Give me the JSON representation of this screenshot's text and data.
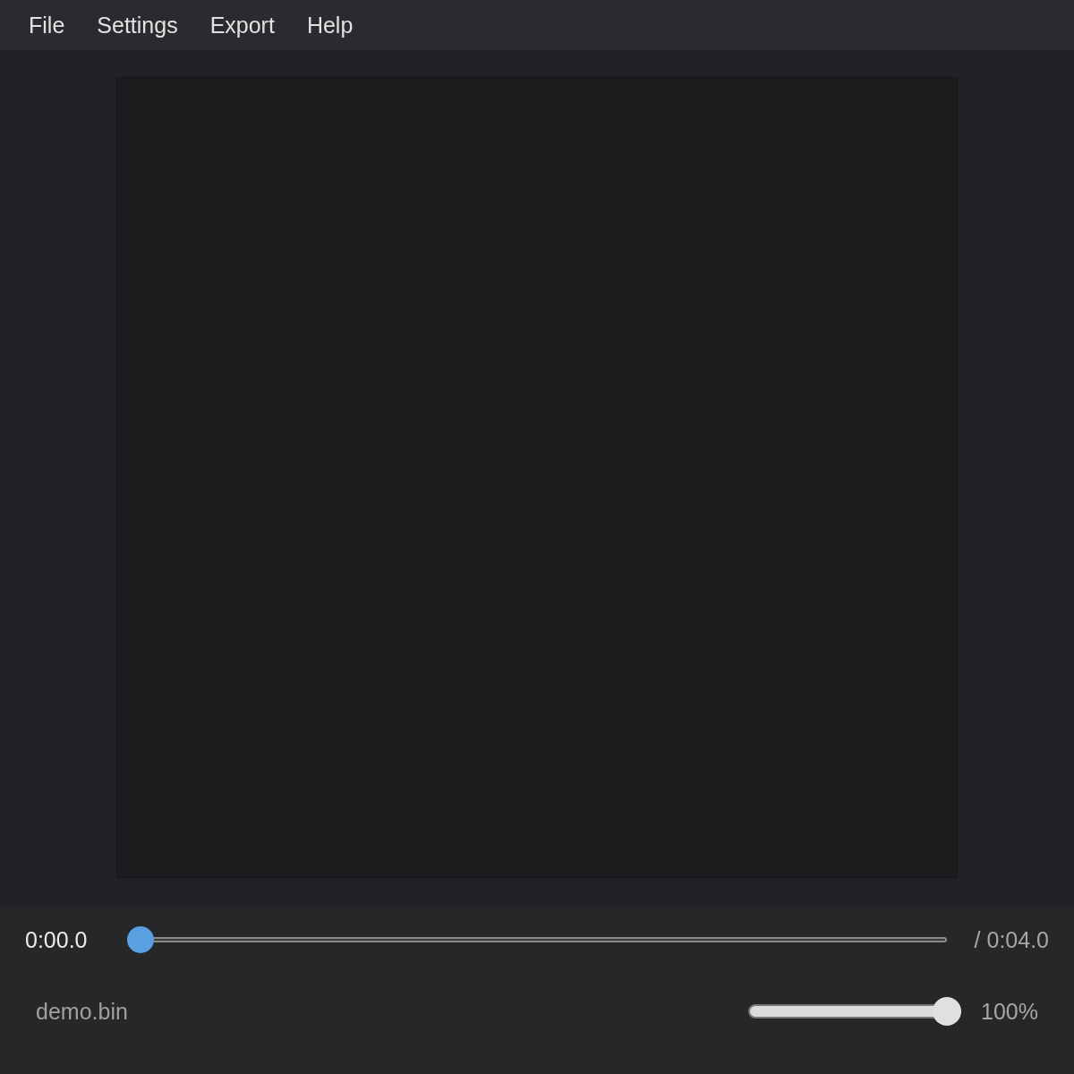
{
  "menu": [
    "File",
    "Settings",
    "Export",
    "Help"
  ],
  "playback": {
    "current_time": "0:00.0",
    "seek": {
      "level": 0
    },
    "duration": "/ 0:04.0"
  },
  "file_name": "demo.bin",
  "volume": {
    "level": 1,
    "reading": "100%"
  }
}
